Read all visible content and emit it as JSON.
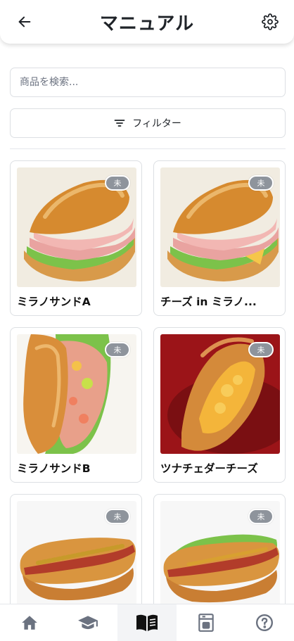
{
  "header": {
    "title": "マニュアル"
  },
  "search": {
    "placeholder": "商品を検索..."
  },
  "filter": {
    "label": "フィルター"
  },
  "products": [
    {
      "name": "ミラノサンドA",
      "badge": "未",
      "image": "milano-sandwich-ham"
    },
    {
      "name": "チーズ in ミラノ...",
      "badge": "未",
      "image": "milano-sandwich-ham-cheese"
    },
    {
      "name": "ミラノサンドB",
      "badge": "未",
      "image": "milano-sandwich-shrimp-avocado"
    },
    {
      "name": "ツナチェダーチーズ",
      "badge": "未",
      "image": "tuna-cheddar-sandwich"
    },
    {
      "name": "",
      "badge": "未",
      "image": "hotdog-mustard"
    },
    {
      "name": "",
      "badge": "未",
      "image": "hotdog-lettuce"
    }
  ],
  "bottom_nav": [
    {
      "icon": "home-icon",
      "active": false
    },
    {
      "icon": "graduation-cap-icon",
      "active": false
    },
    {
      "icon": "book-open-icon",
      "active": true
    },
    {
      "icon": "coffee-machine-icon",
      "active": false
    },
    {
      "icon": "help-circle-icon",
      "active": false
    }
  ],
  "colors": {
    "badge": "#8e949c",
    "border": "#dcdfe3",
    "text": "#1f2328",
    "nav_icon": "#6b7280",
    "nav_active_icon": "#111111"
  }
}
